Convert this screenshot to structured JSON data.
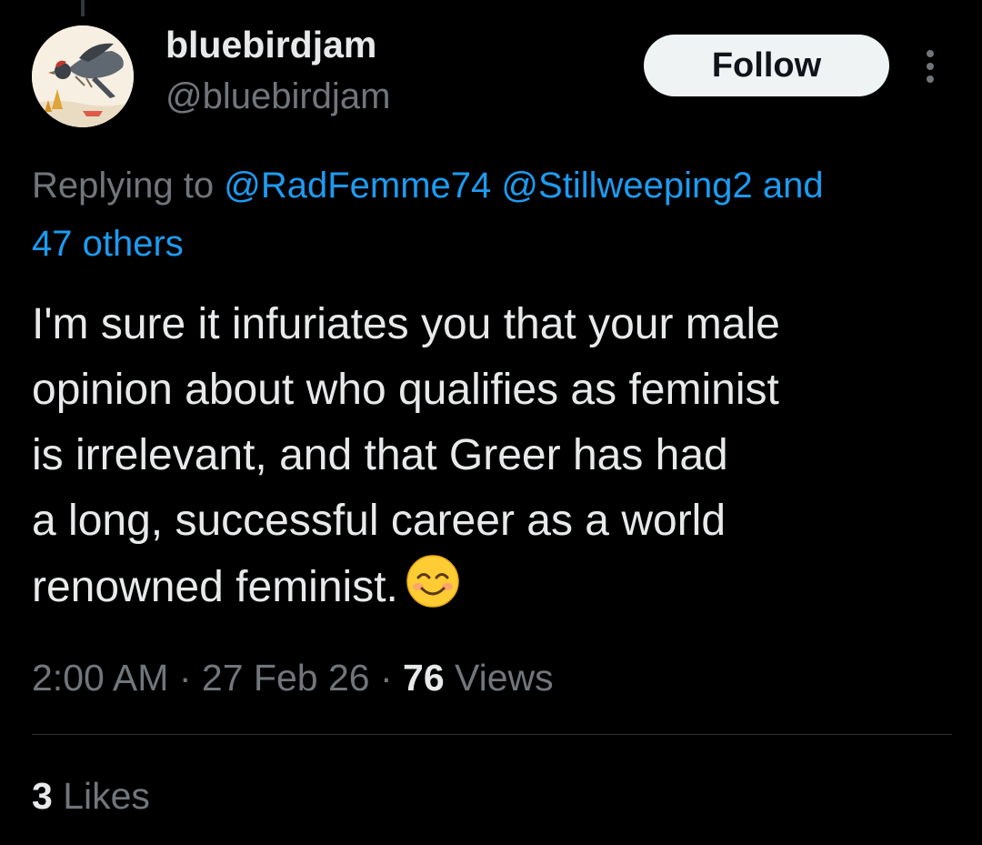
{
  "author": {
    "display_name": "bluebirdjam",
    "handle": "@bluebirdjam",
    "avatar_icon": "bird-painting-avatar"
  },
  "actions": {
    "follow_label": "Follow",
    "more_icon": "vertical-ellipsis-icon"
  },
  "reply_context": {
    "prefix": "Replying to",
    "mentions": [
      "@RadFemme74",
      "@Stillweeping2"
    ],
    "tail": "and",
    "others": "47 others"
  },
  "tweet": {
    "text": "I'm sure it infuriates you that your male\nopinion about who qualifies as feminist\nis irrelevant, and that Greer has had\na long, successful career as a world\nrenowned feminist.",
    "emoji": "smiling-face-with-smiling-eyes-emoji"
  },
  "meta": {
    "time": "2:00 AM",
    "separator": "·",
    "date": "27 Feb 26",
    "views_count": "76",
    "views_label": "Views"
  },
  "engagement": {
    "likes_count": "3",
    "likes_label": "Likes"
  },
  "colors": {
    "background": "#000000",
    "text": "#e7e9ea",
    "secondary": "#71767b",
    "link": "#1d9bf0",
    "follow_bg": "#eff3f4",
    "divider": "#2f3336"
  }
}
